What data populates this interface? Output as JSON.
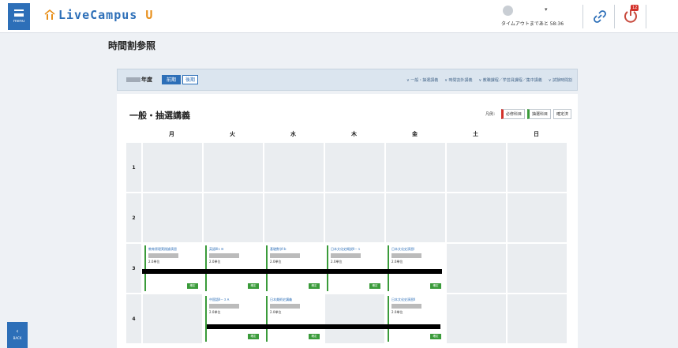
{
  "header": {
    "menu_label": "menu",
    "logo_text": "LiveCampus",
    "logo_suffix": "U",
    "user_chevron": "▾",
    "timeout_text": "タイムアウトまであと 58:36",
    "badge_count": "12"
  },
  "page": {
    "title": "時間割参照"
  },
  "year_bar": {
    "year_suffix": "年度",
    "tab_selected": "前期",
    "tab_unselected": "後期",
    "nav_links": [
      "∨ 一般・抽選講義",
      "∨ 時間割外講義",
      "∨ 教職課程／学芸員課程／集中講義",
      "∨ 試験時間割"
    ]
  },
  "section": {
    "title": "一般・抽選講義"
  },
  "legend": {
    "label": "凡例：",
    "required": "必修科目",
    "selected": "抽選科目",
    "confirmed": "確定済"
  },
  "days": [
    "月",
    "火",
    "水",
    "木",
    "金",
    "土",
    "日"
  ],
  "periods": [
    {
      "num": "1",
      "cells": [
        null,
        null,
        null,
        null,
        null,
        null,
        null
      ]
    },
    {
      "num": "2",
      "cells": [
        null,
        null,
        null,
        null,
        null,
        null,
        null
      ]
    },
    {
      "num": "3",
      "cells": [
        {
          "name": "教育原理実践論演習",
          "credits": "2.0単位",
          "status": "確定"
        },
        {
          "name": "英語Ⅲ１Ｂ",
          "credits": "2.0単位",
          "status": "確定"
        },
        {
          "name": "基礎数学Ⅰｂ",
          "credits": "2.0単位",
          "status": "確定"
        },
        {
          "name": "日本文化史概説Ⅱ－１",
          "credits": "2.0単位",
          "status": "確定"
        },
        {
          "name": "日本文化史演習Ⅰ",
          "credits": "2.0単位",
          "status": "確定"
        },
        null,
        null
      ]
    },
    {
      "num": "4",
      "cells": [
        null,
        {
          "name": "中国語Ⅱ－３Ａ",
          "credits": "2.0単位",
          "status": "確定"
        },
        {
          "name": "日本美術史講義",
          "credits": "2.0単位",
          "status": "確定"
        },
        null,
        {
          "name": "日本文化史演習Ⅱ",
          "credits": "2.0単位",
          "status": "確定"
        },
        null,
        null
      ]
    }
  ],
  "back": {
    "arrow": "‹",
    "label": "BACK"
  },
  "colors": {
    "accent": "#2d6fb8",
    "brand_orange": "#e88f1a",
    "confirmed_green": "#3a9b3a",
    "required_red": "#d3312a"
  }
}
